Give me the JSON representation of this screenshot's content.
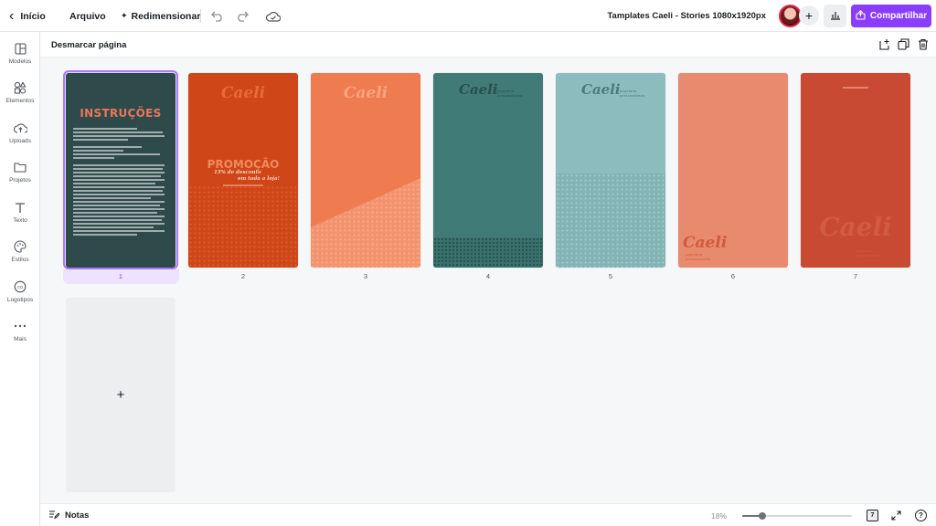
{
  "topbar": {
    "back_label": "Início",
    "file_label": "Arquivo",
    "resize_label": "Redimensionar",
    "design_title": "Tamplates Caeli - Stories 1080x1920px",
    "share_label": "Compartilhar",
    "add_label": "+"
  },
  "sidebar": {
    "items": [
      {
        "label": "Modelos",
        "icon": "templates-icon"
      },
      {
        "label": "Elementos",
        "icon": "elements-icon"
      },
      {
        "label": "Uploads",
        "icon": "upload-cloud-icon"
      },
      {
        "label": "Projetos",
        "icon": "folder-icon"
      },
      {
        "label": "Texto",
        "icon": "text-icon"
      },
      {
        "label": "Estilos",
        "icon": "palette-icon"
      },
      {
        "label": "Logotipos",
        "icon": "logo-icon"
      },
      {
        "label": "Mais",
        "icon": "more-icon"
      }
    ]
  },
  "page_header": {
    "title": "Desmarcar página"
  },
  "pages": [
    {
      "number": "1",
      "bg": "#2f4a4a",
      "selected": true,
      "title": "INSTRUÇÕES"
    },
    {
      "number": "2",
      "bg": "#cf4718",
      "brand": "Caeli",
      "promo_title": "PROMOÇÃO",
      "promo_sub1": "15% de desconto",
      "promo_sub2": "em toda a loja!"
    },
    {
      "number": "3",
      "bg": "#ef7b50",
      "brand": "Caeli"
    },
    {
      "number": "4",
      "bg": "#417b77",
      "brand": "Caeli",
      "brand_sub": "papelaria personalizada"
    },
    {
      "number": "5",
      "bg": "#8cbcbd",
      "brand": "Caeli",
      "brand_sub": "papelaria personalizada"
    },
    {
      "number": "6",
      "bg": "#e88a6e",
      "brand": "Caeli",
      "brand_sub": "papelaria personalizada"
    },
    {
      "number": "7",
      "bg": "#c84a32",
      "brand": "Caeli",
      "brand_sub": "papelaria personalizada"
    }
  ],
  "add_page_label": "+",
  "bottombar": {
    "notes_label": "Notas",
    "zoom_label": "18%",
    "zoom_fraction": 0.18,
    "page_count_label": "7",
    "help_label": "?"
  },
  "colors": {
    "accent": "#8b3dff",
    "selected_bg": "#ede2ff"
  }
}
